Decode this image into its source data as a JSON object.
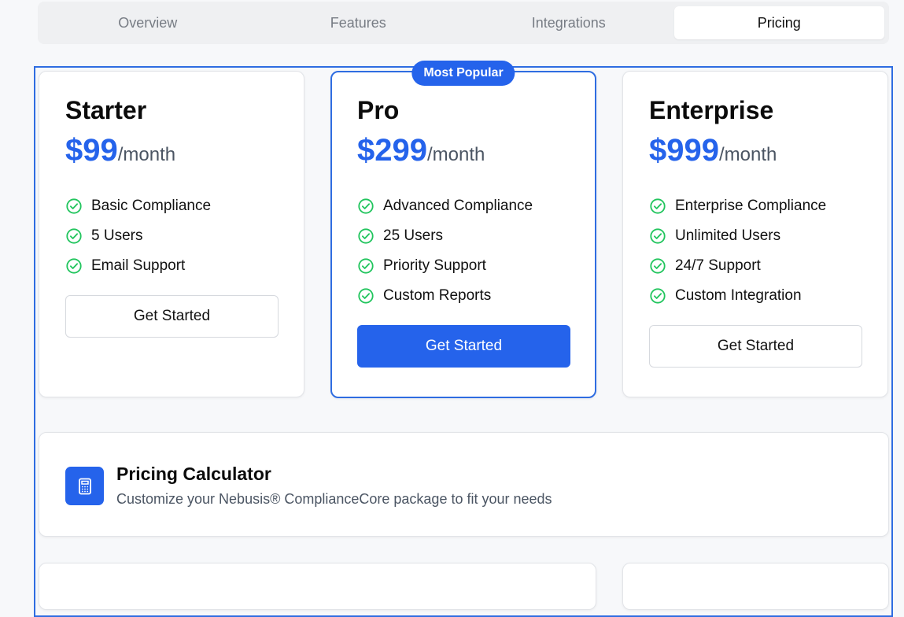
{
  "tabs": [
    {
      "label": "Overview"
    },
    {
      "label": "Features"
    },
    {
      "label": "Integrations"
    },
    {
      "label": "Pricing"
    }
  ],
  "active_tab": "Pricing",
  "plans": [
    {
      "name": "Starter",
      "price": "$99",
      "period": "/month",
      "features": [
        "Basic Compliance",
        "5 Users",
        "Email Support"
      ],
      "cta": "Get Started"
    },
    {
      "name": "Pro",
      "badge": "Most Popular",
      "price": "$299",
      "period": "/month",
      "features": [
        "Advanced Compliance",
        "25 Users",
        "Priority Support",
        "Custom Reports"
      ],
      "cta": "Get Started"
    },
    {
      "name": "Enterprise",
      "price": "$999",
      "period": "/month",
      "features": [
        "Enterprise Compliance",
        "Unlimited Users",
        "24/7 Support",
        "Custom Integration"
      ],
      "cta": "Get Started"
    }
  ],
  "calculator": {
    "title": "Pricing Calculator",
    "subtitle": "Customize your Nebusis® ComplianceCore package to fit your needs",
    "icon": "calculator-icon"
  },
  "colors": {
    "accent": "#2563eb",
    "check": "#22c55e",
    "frame": "#2f6de1"
  }
}
